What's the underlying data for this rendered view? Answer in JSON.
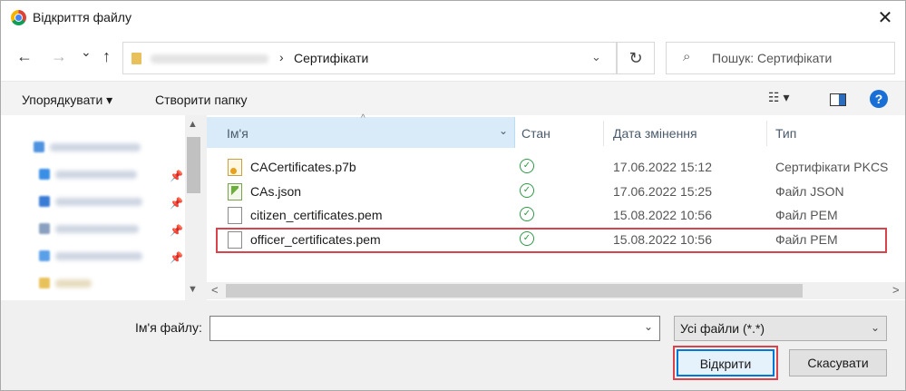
{
  "window": {
    "title": "Відкриття файлу",
    "close_glyph": "✕"
  },
  "nav": {
    "back_glyph": "←",
    "forward_glyph": "→",
    "recent_glyph": "⌄",
    "up_glyph": "↑",
    "breadcrumb": "Сертифікати",
    "separator": "›",
    "refresh_glyph": "↻",
    "search_placeholder": "Пошук: Сертифікати",
    "search_glyph": "⌕"
  },
  "toolbar": {
    "organize_label": "Упорядкувати ▾",
    "new_folder_label": "Створити папку",
    "view_glyph": "☷ ▾",
    "help_label": "?"
  },
  "columns": {
    "name": "Ім'я",
    "status": "Стан",
    "date": "Дата змінення",
    "type": "Тип",
    "sort_glyph": "^"
  },
  "files": [
    {
      "name": "CACertificates.p7b",
      "icon": "certificate-file-icon",
      "status": "✓",
      "date": "17.06.2022 15:12",
      "type": "Сертифікати PKCS"
    },
    {
      "name": "CAs.json",
      "icon": "json-file-icon",
      "status": "✓",
      "date": "17.06.2022 15:25",
      "type": "Файл JSON"
    },
    {
      "name": "citizen_certificates.pem",
      "icon": "pem-file-icon",
      "status": "✓",
      "date": "15.08.2022 10:56",
      "type": "Файл PEM"
    },
    {
      "name": "officer_certificates.pem",
      "icon": "pem-file-icon",
      "status": "✓",
      "date": "15.08.2022 10:56",
      "type": "Файл PEM"
    }
  ],
  "bottom": {
    "filename_label": "Ім'я файлу:",
    "filename_value": "",
    "filter_value": "Усі файли (*.*)",
    "open_label": "Відкрити",
    "cancel_label": "Скасувати",
    "dropdown_glyph": "⌄"
  },
  "colors": {
    "highlight": "#d9434c",
    "accent": "#0078d7",
    "status_ok": "#2e9a47"
  }
}
